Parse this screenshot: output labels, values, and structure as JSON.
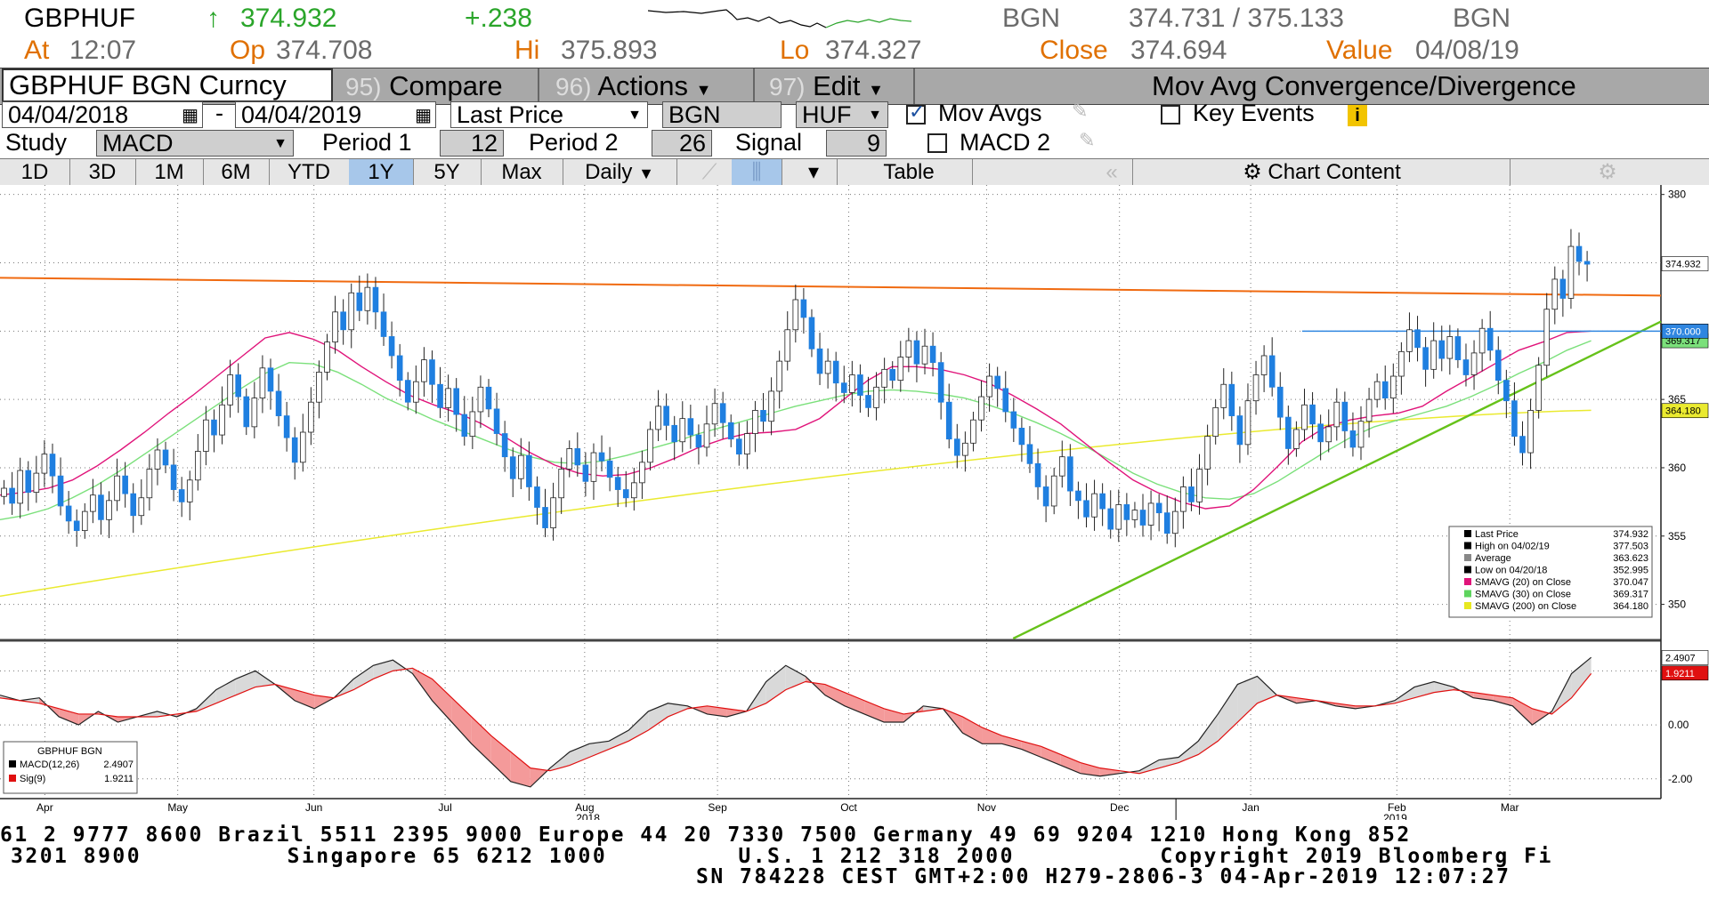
{
  "quote": {
    "ticker": "GBPHUF",
    "arrow": "↑",
    "last": "374.932",
    "change": "+.238",
    "source": "BGN",
    "bid_ask": "374.731 / 375.133",
    "source2": "BGN",
    "at_label": "At",
    "at_value": "12:07",
    "op_label": "Op",
    "op_value": "374.708",
    "hi_label": "Hi",
    "hi_value": "375.893",
    "lo_label": "Lo",
    "lo_value": "374.327",
    "close_label": "Close",
    "close_value": "374.694",
    "value_label": "Value",
    "value_value": "04/08/19"
  },
  "menubar": {
    "security": "GBPHUF BGN Curncy",
    "compare_num": "95)",
    "compare": "Compare",
    "actions_num": "96)",
    "actions": "Actions",
    "edit_num": "97)",
    "edit": "Edit",
    "title": "Mov Avg Convergence/Divergence"
  },
  "controls": {
    "start_date": "04/04/2018",
    "dash": "-",
    "end_date": "04/04/2019",
    "price_type": "Last Price",
    "source": "BGN",
    "currency": "HUF",
    "mov_avgs": "Mov Avgs",
    "key_events": "Key Events",
    "study_label": "Study",
    "study": "MACD",
    "period1_label": "Period 1",
    "period1": "12",
    "period2_label": "Period 2",
    "period2": "26",
    "signal_label": "Signal",
    "signal": "9",
    "macd2": "MACD 2"
  },
  "tabs": {
    "ranges": [
      "1D",
      "3D",
      "1M",
      "6M",
      "YTD",
      "1Y",
      "5Y",
      "Max"
    ],
    "active": "1Y",
    "frequency": "Daily",
    "table": "Table",
    "chart_content": "Chart Content"
  },
  "chart_data": {
    "type": "candlestick",
    "price_axis": {
      "ticks": [
        "350",
        "355",
        "360",
        "365",
        "370",
        "375",
        "380"
      ],
      "range": [
        347.5,
        380.5
      ]
    },
    "price_tags": {
      "last": "374.932",
      "level": "370.000",
      "sma30": "369.317",
      "sma200": "364.180"
    },
    "x_months": [
      "Apr",
      "May",
      "Jun",
      "Jul",
      "Aug",
      "Sep",
      "Oct",
      "Nov",
      "Dec",
      "Jan",
      "Feb",
      "Mar"
    ],
    "x_years": [
      "2018",
      "2019"
    ],
    "series_closes": [
      358.5,
      357.4,
      359.8,
      358.2,
      359.6,
      361.0,
      359.4,
      357.2,
      356.1,
      355.4,
      356.8,
      358.0,
      356.2,
      357.6,
      359.4,
      358.1,
      356.5,
      357.8,
      359.9,
      361.3,
      360.2,
      358.4,
      357.5,
      359.1,
      361.2,
      363.5,
      362.4,
      364.6,
      366.8,
      365.2,
      363.0,
      365.1,
      367.3,
      365.6,
      363.8,
      362.2,
      360.4,
      362.6,
      364.8,
      367.0,
      369.2,
      371.4,
      370.1,
      372.8,
      371.5,
      373.2,
      371.4,
      369.6,
      368.2,
      366.4,
      364.8,
      366.3,
      367.9,
      366.1,
      364.4,
      365.8,
      363.9,
      362.3,
      364.1,
      365.9,
      364.3,
      362.5,
      360.8,
      359.2,
      360.9,
      358.6,
      357.1,
      355.6,
      357.8,
      359.9,
      361.4,
      360.2,
      359.0,
      361.1,
      360.5,
      359.3,
      358.4,
      357.8,
      358.9,
      360.4,
      362.8,
      364.5,
      363.1,
      361.9,
      363.6,
      362.4,
      361.5,
      363.2,
      364.7,
      363.3,
      362.1,
      361.0,
      362.5,
      364.2,
      363.4,
      365.6,
      367.8,
      370.1,
      372.3,
      371.0,
      368.7,
      366.9,
      367.8,
      366.2,
      365.5,
      366.8,
      365.3,
      364.4,
      365.9,
      367.2,
      366.4,
      368.1,
      369.3,
      367.6,
      368.9,
      367.7,
      364.8,
      362.1,
      360.9,
      361.8,
      363.5,
      365.2,
      366.7,
      365.8,
      364.1,
      362.9,
      361.7,
      360.3,
      358.6,
      357.2,
      359.4,
      360.8,
      358.3,
      357.6,
      356.4,
      358.1,
      357.0,
      355.5,
      357.3,
      356.2,
      356.9,
      355.8,
      357.4,
      356.7,
      355.2,
      356.8,
      358.6,
      357.5,
      359.9,
      362.3,
      364.4,
      366.1,
      363.8,
      361.7,
      364.9,
      366.8,
      368.2,
      365.9,
      363.7,
      361.4,
      362.8,
      364.6,
      363.2,
      361.9,
      363.0,
      364.8,
      362.7,
      361.5,
      363.4,
      365.0,
      366.3,
      365.1,
      366.7,
      368.5,
      370.1,
      368.8,
      367.2,
      369.3,
      368.0,
      369.6,
      367.9,
      366.8,
      368.4,
      370.2,
      368.6,
      366.4,
      364.9,
      362.3,
      361.1,
      364.2,
      367.5,
      371.6,
      373.8,
      372.4,
      376.2,
      375.1,
      374.9
    ],
    "sma20": [
      358.0,
      358.2,
      358.5,
      359.1,
      360.1,
      361.3,
      362.6,
      364.0,
      365.3,
      366.7,
      368.1,
      369.5,
      369.9,
      369.4,
      368.6,
      367.4,
      366.3,
      365.3,
      364.6,
      364.0,
      363.2,
      362.2,
      361.1,
      360.2,
      359.6,
      359.4,
      359.5,
      360.0,
      360.7,
      361.5,
      362.1,
      362.5,
      362.6,
      362.8,
      363.6,
      365.0,
      366.4,
      367.4,
      367.4,
      367.2,
      366.8,
      366.2,
      365.3,
      364.3,
      363.2,
      361.8,
      360.4,
      359.1,
      358.2,
      357.5,
      357.0,
      357.2,
      358.4,
      360.1,
      361.9,
      363.0,
      363.5,
      363.8,
      364.0,
      364.5,
      365.6,
      366.6,
      367.6,
      368.6,
      369.2,
      369.9,
      370.0
    ],
    "sma30": [
      356.2,
      356.5,
      357.0,
      357.8,
      358.7,
      359.8,
      361.0,
      362.2,
      363.4,
      364.6,
      365.8,
      366.9,
      367.7,
      367.6,
      367.0,
      366.1,
      365.1,
      364.3,
      363.5,
      362.8,
      362.1,
      361.4,
      360.8,
      360.4,
      360.3,
      360.5,
      360.9,
      361.4,
      361.9,
      362.5,
      363.0,
      363.5,
      364.0,
      364.5,
      364.9,
      365.3,
      365.6,
      365.7,
      365.6,
      365.4,
      365.1,
      364.6,
      364.0,
      363.3,
      362.5,
      361.6,
      360.6,
      359.6,
      358.8,
      358.2,
      357.8,
      357.7,
      358.1,
      359.0,
      360.1,
      361.2,
      362.2,
      363.0,
      363.5,
      364.0,
      364.5,
      365.2,
      366.0,
      366.9,
      367.7,
      368.6,
      369.3
    ],
    "sma200": {
      "start": 350.6,
      "end": 364.2
    },
    "trendline_resistance": {
      "from": [
        0,
        373.9
      ],
      "to": [
        1,
        372.6
      ]
    },
    "trendline_support": {
      "from": [
        0.61,
        347.5
      ],
      "to": [
        1,
        370.7
      ]
    },
    "horizontal_level": 370.0,
    "legend": {
      "rows": [
        {
          "label": "Last Price",
          "value": "374.932",
          "color": "#000000"
        },
        {
          "label": "High on 04/02/19",
          "value": "377.503",
          "color": "#000000"
        },
        {
          "label": "Average",
          "value": "363.623",
          "color": "#888888"
        },
        {
          "label": "Low on 04/20/18",
          "value": "352.995",
          "color": "#000000"
        },
        {
          "label": "SMAVG (20)  on Close",
          "value": "370.047",
          "color": "#e0147a"
        },
        {
          "label": "SMAVG (30)  on Close",
          "value": "369.317",
          "color": "#5ed45e"
        },
        {
          "label": "SMAVG (200)  on Close",
          "value": "364.180",
          "color": "#e8e820"
        }
      ]
    },
    "macd": {
      "axis_ticks": [
        "2.00",
        "0.00",
        "-2.00"
      ],
      "range": [
        -2.6,
        3.0
      ],
      "macd_tag": "2.4907",
      "signal_tag": "1.9211",
      "legend_title": "GBPHUF BGN",
      "legend_macd_label": "MACD(12,26)",
      "legend_macd_value": "2.4907",
      "legend_sig_label": "Sig(9)",
      "legend_sig_value": "1.9211",
      "macd_values": [
        1.1,
        0.9,
        1.0,
        0.3,
        0.0,
        0.5,
        0.1,
        0.3,
        0.5,
        0.3,
        0.6,
        1.3,
        1.7,
        2.0,
        1.5,
        0.9,
        0.6,
        1.0,
        1.7,
        2.2,
        2.4,
        1.9,
        0.9,
        0.1,
        -0.7,
        -1.4,
        -2.1,
        -2.3,
        -1.6,
        -1.0,
        -0.7,
        -0.6,
        -0.2,
        0.5,
        0.8,
        0.7,
        0.4,
        0.3,
        0.5,
        1.6,
        2.2,
        1.8,
        1.1,
        0.7,
        0.4,
        0.1,
        0.1,
        0.7,
        0.6,
        -0.3,
        -0.7,
        -0.7,
        -0.9,
        -1.2,
        -1.5,
        -1.8,
        -1.9,
        -1.8,
        -1.7,
        -1.3,
        -1.2,
        -0.6,
        0.4,
        1.5,
        1.8,
        1.1,
        0.8,
        0.9,
        0.7,
        0.6,
        0.7,
        0.9,
        1.4,
        1.6,
        1.4,
        1.0,
        0.9,
        0.7,
        0.0,
        0.5,
        1.9,
        2.5
      ],
      "signal_values": [
        1.0,
        0.9,
        0.8,
        0.6,
        0.4,
        0.4,
        0.3,
        0.3,
        0.3,
        0.4,
        0.5,
        0.8,
        1.1,
        1.4,
        1.5,
        1.3,
        1.1,
        1.0,
        1.3,
        1.7,
        2.0,
        2.1,
        1.7,
        1.0,
        0.3,
        -0.4,
        -1.0,
        -1.6,
        -1.7,
        -1.5,
        -1.2,
        -0.9,
        -0.6,
        -0.2,
        0.3,
        0.6,
        0.7,
        0.6,
        0.5,
        0.8,
        1.3,
        1.6,
        1.5,
        1.2,
        0.9,
        0.6,
        0.4,
        0.5,
        0.6,
        0.3,
        -0.1,
        -0.4,
        -0.6,
        -0.8,
        -1.1,
        -1.4,
        -1.6,
        -1.7,
        -1.8,
        -1.6,
        -1.4,
        -1.1,
        -0.6,
        0.1,
        0.8,
        1.1,
        1.0,
        0.9,
        0.8,
        0.7,
        0.7,
        0.8,
        1.0,
        1.2,
        1.3,
        1.2,
        1.1,
        1.0,
        0.6,
        0.4,
        1.0,
        1.9
      ]
    }
  },
  "footer": {
    "line1": "61 2 9777 8600 Brazil 5511 2395 9000 Europe 44 20 7330 7500 Germany 49 69 9204 1210 Hong Kong 852",
    "line2": "3201 8900          Singapore 65 6212 1000         U.S. 1 212 318 2000          Copyright 2019 Bloomberg Fi",
    "line3": "SN 784228 CEST GMT+2:00 H279-2806-3 04-Apr-2019 12:07:27"
  }
}
